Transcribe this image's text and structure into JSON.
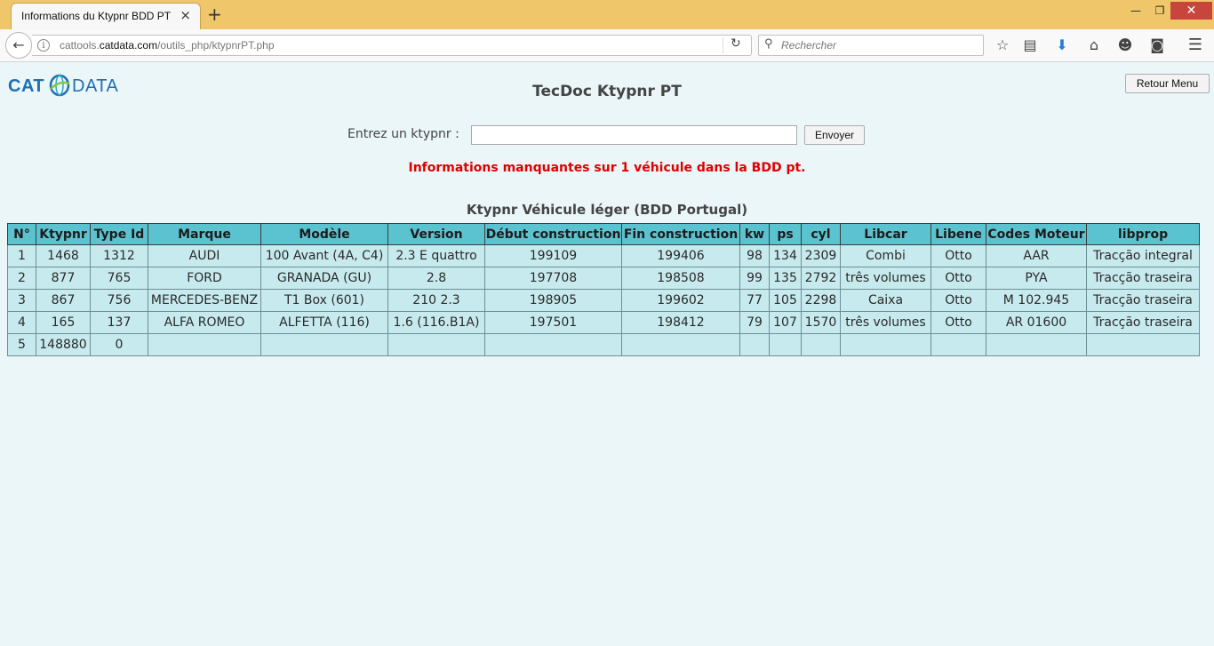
{
  "browser": {
    "tab_title": "Informations du Ktypnr BDD PT",
    "tab_close": "×",
    "new_tab": "+",
    "url_prefix": "cattools.",
    "url_domain": "catdata.com",
    "url_path": "/outils_php/ktypnrPT.php",
    "search_placeholder": "Rechercher",
    "icons": [
      "back-icon",
      "info-icon",
      "reload-icon",
      "search-icon",
      "bookmark-star-icon",
      "reading-list-icon",
      "download-icon",
      "home-icon",
      "hello-icon",
      "pocket-icon",
      "menu-icon"
    ]
  },
  "page": {
    "logo_left": "CAT",
    "logo_right": "DATA",
    "title": "TecDoc Ktypnr PT",
    "menu_button": "Retour Menu",
    "form_label": "Entrez un ktypnr :",
    "input_value": "",
    "send_button": "Envoyer",
    "alert": "Informations manquantes sur 1 véhicule dans la BDD pt.",
    "table_title": "Ktypnr Véhicule léger (BDD Portugal)"
  },
  "colors": {
    "page_bg": "#eaf6f8",
    "header_bg": "#5bc3d0",
    "cell_bg": "#c7eaee",
    "alert": "#e00000",
    "titlebar": "#f0c66b"
  },
  "table": {
    "columns": [
      "N°",
      "Ktypnr",
      "Type Id",
      "Marque",
      "Modèle",
      "Version",
      "Début construction",
      "Fin construction",
      "kw",
      "ps",
      "cyl",
      "Libcar",
      "Libene",
      "Codes Moteur",
      "libprop"
    ],
    "rows": [
      [
        "1",
        "1468",
        "1312",
        "AUDI",
        "100 Avant (4A, C4)",
        "2.3 E quattro",
        "199109",
        "199406",
        "98",
        "134",
        "2309",
        "Combi",
        "Otto",
        "AAR",
        "Tracção integral"
      ],
      [
        "2",
        "877",
        "765",
        "FORD",
        "GRANADA (GU)",
        "2.8",
        "197708",
        "198508",
        "99",
        "135",
        "2792",
        "três volumes",
        "Otto",
        "PYA",
        "Tracção traseira"
      ],
      [
        "3",
        "867",
        "756",
        "MERCEDES-BENZ",
        "T1 Box (601)",
        "210 2.3",
        "198905",
        "199602",
        "77",
        "105",
        "2298",
        "Caixa",
        "Otto",
        "M 102.945",
        "Tracção traseira"
      ],
      [
        "4",
        "165",
        "137",
        "ALFA ROMEO",
        "ALFETTA (116)",
        "1.6 (116.B1A)",
        "197501",
        "198412",
        "79",
        "107",
        "1570",
        "três volumes",
        "Otto",
        "AR 01600",
        "Tracção traseira"
      ],
      [
        "5",
        "148880",
        "0",
        "",
        "",
        "",
        "",
        "",
        "",
        "",
        "",
        "",
        "",
        "",
        ""
      ]
    ]
  }
}
